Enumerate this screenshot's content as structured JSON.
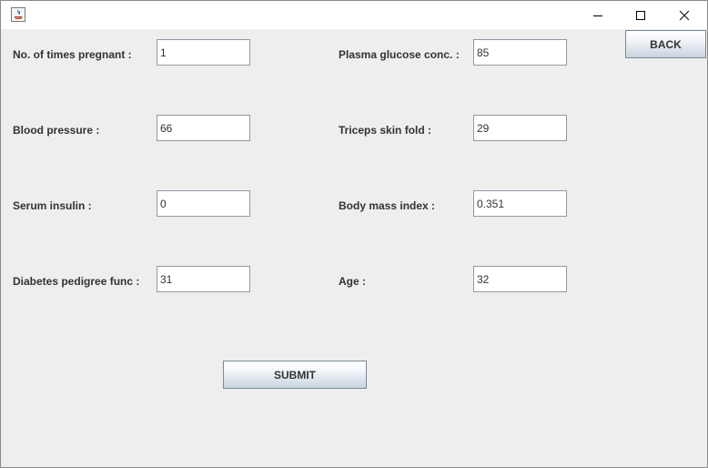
{
  "window": {
    "controls": {
      "minimize_icon": "minimize-icon",
      "maximize_icon": "maximize-icon",
      "close_icon": "close-icon"
    },
    "app_icon": "java-coffee-cup-icon"
  },
  "buttons": {
    "back_label": "BACK",
    "submit_label": "SUBMIT"
  },
  "form": {
    "pregnancies": {
      "label": "No. of times pregnant :",
      "value": "1"
    },
    "glucose": {
      "label": "Plasma glucose conc. :",
      "value": "85"
    },
    "blood_pressure": {
      "label": "Blood pressure :",
      "value": "66"
    },
    "skin_thickness": {
      "label": "Triceps skin fold :",
      "value": "29"
    },
    "insulin": {
      "label": "Serum insulin :",
      "value": "0"
    },
    "bmi": {
      "label": "Body mass index :",
      "value": "0.351"
    },
    "pedigree": {
      "label": "Diabetes pedigree func :",
      "value": "31"
    },
    "age": {
      "label": "Age :",
      "value": "32"
    }
  },
  "colors": {
    "panel_background": "#eeeeee",
    "field_border": "#8f9aa6",
    "label_text": "#333333"
  }
}
